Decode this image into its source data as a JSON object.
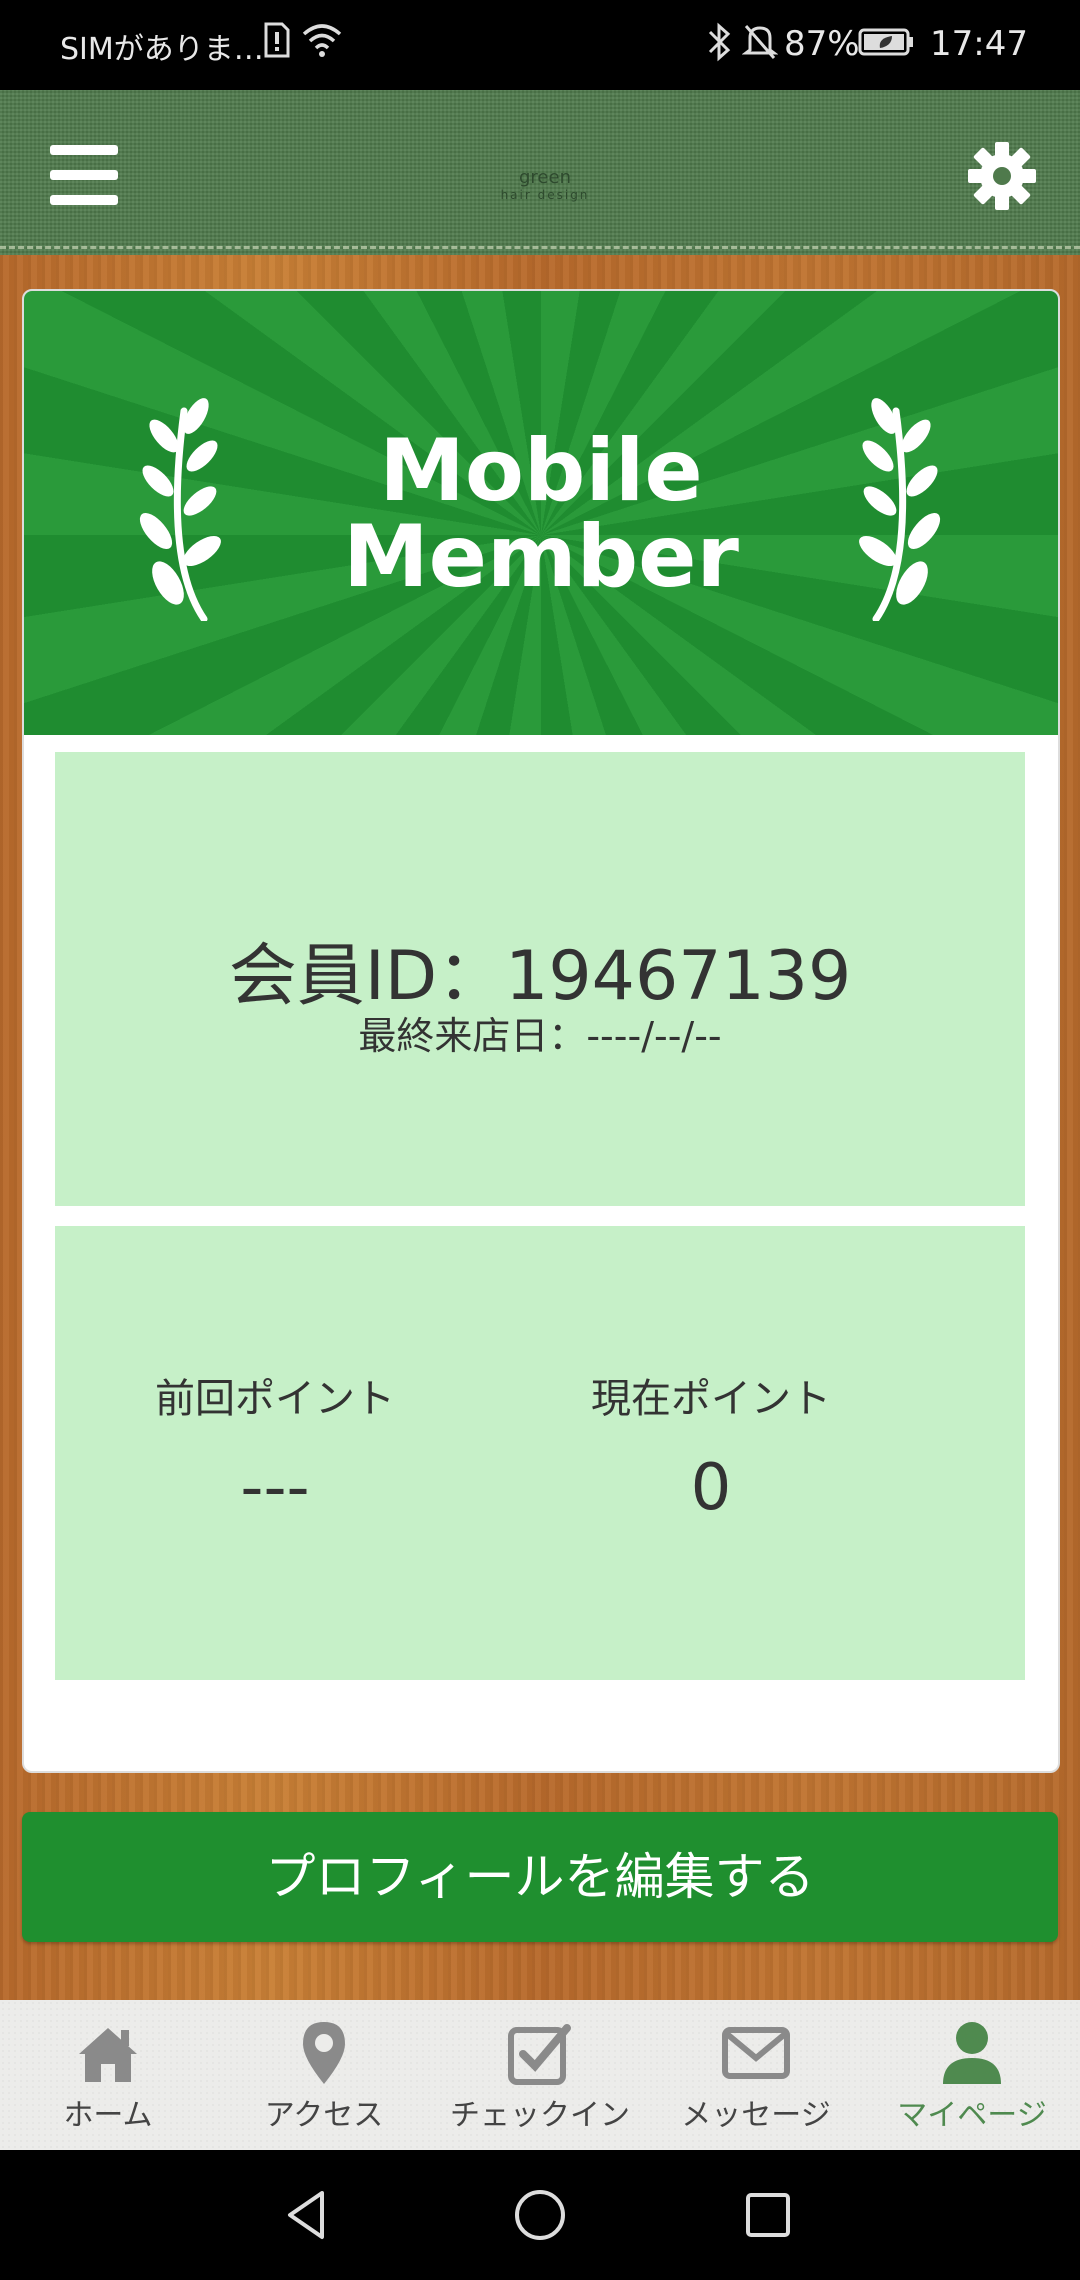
{
  "status_bar": {
    "carrier": "SIMがありま…",
    "battery": "87%",
    "time": "17:47"
  },
  "header": {
    "logo_line1": "green",
    "logo_line2": "hair design"
  },
  "banner": {
    "title_line1": "Mobile",
    "title_line2": "Member"
  },
  "member": {
    "id_text": "会員ID：19467139",
    "last_visit": "最終来店日：----/--/--"
  },
  "points": {
    "previous_label": "前回ポイント",
    "previous_value": "---",
    "current_label": "現在ポイント",
    "current_value": "0"
  },
  "edit_profile_label": "プロフィールを編集する",
  "tabs": [
    {
      "label": "ホーム",
      "icon": "home-icon"
    },
    {
      "label": "アクセス",
      "icon": "map-pin-icon"
    },
    {
      "label": "チェックイン",
      "icon": "checkin-icon"
    },
    {
      "label": "メッセージ",
      "icon": "envelope-icon"
    },
    {
      "label": "マイページ",
      "icon": "person-icon",
      "active": true
    }
  ],
  "colors": {
    "accent_green": "#1f8f2f",
    "panel_green": "#c6f0c8",
    "active_tab": "#4f8a4f"
  }
}
